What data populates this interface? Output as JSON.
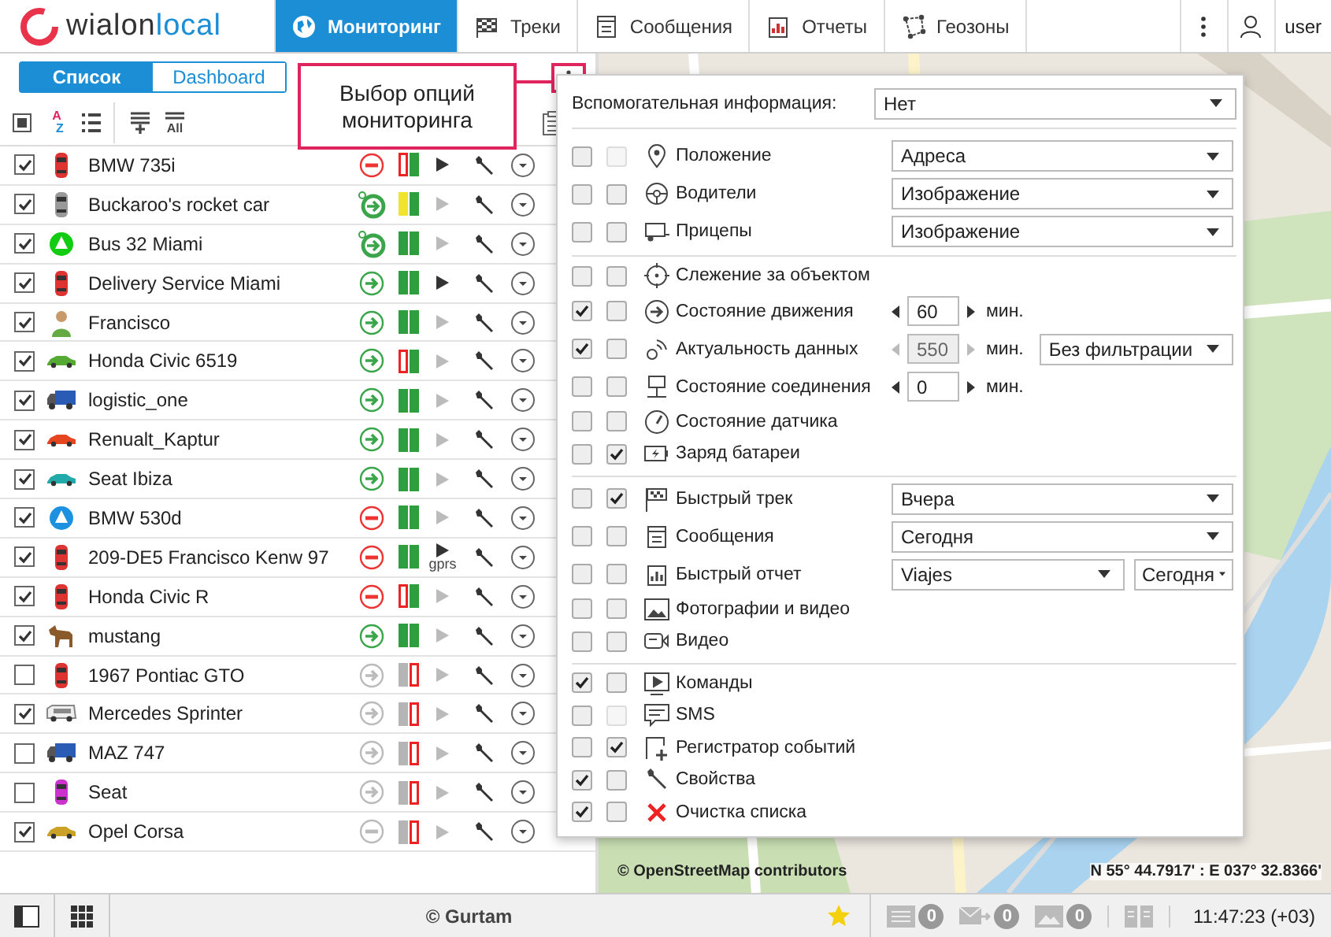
{
  "top_bar": {
    "logo": {
      "name": "wialon",
      "suffix": "local"
    },
    "nav": [
      {
        "label": "Мониторинг",
        "selected": true
      },
      {
        "label": "Треки",
        "selected": false
      },
      {
        "label": "Сообщения",
        "selected": false
      },
      {
        "label": "Отчеты",
        "selected": false
      },
      {
        "label": "Геозоны",
        "selected": false
      }
    ],
    "user": "user"
  },
  "panel": {
    "tabs": [
      {
        "label": "Список",
        "selected": true
      },
      {
        "label": "Dashboard",
        "selected": false
      }
    ],
    "select_all": {
      "indeterminate": true
    },
    "sort_label": {
      "first": "A",
      "second": "Z"
    },
    "all_label": "All"
  },
  "callout": {
    "text": "Выбор опций мониторинга"
  },
  "units": [
    {
      "name": "BMW 735i",
      "checked": true,
      "online": true,
      "moving": false,
      "watched": false,
      "gps_fix": false,
      "gps_weak": false,
      "connected": true,
      "command_enabled": true
    },
    {
      "name": "Buckaroo's rocket car",
      "checked": true,
      "online": true,
      "moving": true,
      "watched": true,
      "gps_fix": false,
      "gps_weak": true,
      "connected": true,
      "command_enabled": false
    },
    {
      "name": "Bus 32 Miami",
      "checked": true,
      "online": true,
      "moving": true,
      "watched": true,
      "gps_fix": true,
      "gps_weak": false,
      "connected": true,
      "command_enabled": false
    },
    {
      "name": "Delivery Service Miami",
      "checked": true,
      "online": true,
      "moving": true,
      "watched": false,
      "gps_fix": true,
      "gps_weak": false,
      "connected": true,
      "command_enabled": true
    },
    {
      "name": "Francisco",
      "checked": true,
      "online": true,
      "moving": true,
      "watched": false,
      "gps_fix": true,
      "gps_weak": false,
      "connected": true,
      "command_enabled": false
    },
    {
      "name": "Honda Civic 6519",
      "checked": true,
      "online": true,
      "moving": true,
      "watched": false,
      "gps_fix": false,
      "gps_weak": false,
      "connected": true,
      "command_enabled": false
    },
    {
      "name": "logistic_one",
      "checked": true,
      "online": true,
      "moving": true,
      "watched": false,
      "gps_fix": true,
      "gps_weak": false,
      "connected": true,
      "command_enabled": false
    },
    {
      "name": "Renualt_Kaptur",
      "checked": true,
      "online": true,
      "moving": true,
      "watched": false,
      "gps_fix": true,
      "gps_weak": false,
      "connected": true,
      "command_enabled": false
    },
    {
      "name": "Seat Ibiza",
      "checked": true,
      "online": true,
      "moving": true,
      "watched": false,
      "gps_fix": true,
      "gps_weak": false,
      "connected": true,
      "command_enabled": false
    },
    {
      "name": "BMW 530d",
      "checked": true,
      "online": true,
      "moving": false,
      "watched": false,
      "gps_fix": true,
      "gps_weak": false,
      "connected": true,
      "command_enabled": false
    },
    {
      "name": "209-DE5 Francisco Kenw 97",
      "checked": true,
      "online": true,
      "moving": false,
      "watched": false,
      "gps_fix": true,
      "gps_weak": false,
      "connected": true,
      "command_enabled": true,
      "command_label": "gprs"
    },
    {
      "name": "Honda Civic R",
      "checked": true,
      "online": true,
      "moving": false,
      "watched": false,
      "gps_fix": false,
      "gps_weak": false,
      "connected": true,
      "command_enabled": false
    },
    {
      "name": "mustang",
      "checked": true,
      "online": true,
      "moving": true,
      "watched": false,
      "gps_fix": true,
      "gps_weak": false,
      "connected": true,
      "command_enabled": false
    },
    {
      "name": "1967 Pontiac GTO",
      "checked": false,
      "online": false,
      "moving": true,
      "watched": false,
      "gps_fix": false,
      "gps_weak": false,
      "connected": false,
      "command_enabled": false
    },
    {
      "name": "Mercedes Sprinter",
      "checked": true,
      "online": false,
      "moving": true,
      "watched": false,
      "gps_fix": false,
      "gps_weak": false,
      "connected": false,
      "command_enabled": false
    },
    {
      "name": "MAZ 747",
      "checked": false,
      "online": false,
      "moving": true,
      "watched": false,
      "gps_fix": false,
      "gps_weak": false,
      "connected": false,
      "command_enabled": false
    },
    {
      "name": "Seat",
      "checked": false,
      "online": false,
      "moving": true,
      "watched": false,
      "gps_fix": false,
      "gps_weak": false,
      "connected": false,
      "command_enabled": false
    },
    {
      "name": "Opel Corsa",
      "checked": true,
      "online": false,
      "moving": false,
      "watched": false,
      "gps_fix": false,
      "gps_weak": false,
      "connected": false,
      "command_enabled": false
    }
  ],
  "options": {
    "header": {
      "label": "Вспомогательная информация:",
      "value": "Нет"
    },
    "sections": [
      [
        {
          "label": "Положение",
          "checks": [
            {
              "checked": false,
              "disabled": false
            },
            {
              "checked": false,
              "disabled": true
            }
          ],
          "controls": [
            {
              "kind": "select",
              "value": "Адреса"
            }
          ]
        },
        {
          "label": "Водители",
          "checks": [
            {
              "checked": false,
              "disabled": false
            },
            {
              "checked": false,
              "disabled": false
            }
          ],
          "controls": [
            {
              "kind": "select",
              "value": "Изображение"
            }
          ]
        },
        {
          "label": "Прицепы",
          "checks": [
            {
              "checked": false,
              "disabled": false
            },
            {
              "checked": false,
              "disabled": false
            }
          ],
          "controls": [
            {
              "kind": "select",
              "value": "Изображение"
            }
          ]
        }
      ],
      [
        {
          "label": "Слежение за объектом",
          "checks": [
            {
              "checked": false,
              "disabled": false
            },
            {
              "checked": false,
              "disabled": false
            }
          ]
        },
        {
          "label": "Состояние движения",
          "checks": [
            {
              "checked": true,
              "disabled": false
            },
            {
              "checked": false,
              "disabled": false
            }
          ],
          "controls": [
            {
              "kind": "spinner",
              "value": "60",
              "unit": "мин.",
              "disabled": false
            }
          ]
        },
        {
          "label": "Актуальность данных",
          "checks": [
            {
              "checked": true,
              "disabled": false
            },
            {
              "checked": false,
              "disabled": false
            }
          ],
          "controls": [
            {
              "kind": "spinner",
              "value": "550",
              "unit": "мин.",
              "disabled": true
            },
            {
              "kind": "select",
              "value": "Без фильтрации"
            }
          ]
        },
        {
          "label": "Состояние соединения",
          "checks": [
            {
              "checked": false,
              "disabled": false
            },
            {
              "checked": false,
              "disabled": false
            }
          ],
          "controls": [
            {
              "kind": "spinner",
              "value": "0",
              "unit": "мин.",
              "disabled": false
            }
          ]
        },
        {
          "label": "Состояние датчика",
          "checks": [
            {
              "checked": false,
              "disabled": false
            },
            {
              "checked": false,
              "disabled": false
            }
          ]
        },
        {
          "label": "Заряд батареи",
          "checks": [
            {
              "checked": false,
              "disabled": false
            },
            {
              "checked": true,
              "disabled": false
            }
          ]
        }
      ],
      [
        {
          "label": "Быстрый трек",
          "checks": [
            {
              "checked": false,
              "disabled": false
            },
            {
              "checked": true,
              "disabled": false
            }
          ],
          "controls": [
            {
              "kind": "select",
              "value": "Вчера"
            }
          ]
        },
        {
          "label": "Сообщения",
          "checks": [
            {
              "checked": false,
              "disabled": false
            },
            {
              "checked": false,
              "disabled": false
            }
          ],
          "controls": [
            {
              "kind": "select",
              "value": "Сегодня"
            }
          ]
        },
        {
          "label": "Быстрый отчет",
          "checks": [
            {
              "checked": false,
              "disabled": false
            },
            {
              "checked": false,
              "disabled": false
            }
          ],
          "controls": [
            {
              "kind": "select",
              "value": "Viajes"
            },
            {
              "kind": "select_small",
              "value": "Сегодня"
            }
          ]
        },
        {
          "label": "Фотографии и видео",
          "checks": [
            {
              "checked": false,
              "disabled": false
            },
            {
              "checked": false,
              "disabled": false
            }
          ]
        },
        {
          "label": "Видео",
          "checks": [
            {
              "checked": false,
              "disabled": false
            },
            {
              "checked": false,
              "disabled": false
            }
          ]
        }
      ],
      [
        {
          "label": "Команды",
          "checks": [
            {
              "checked": true,
              "disabled": false
            },
            {
              "checked": false,
              "disabled": false
            }
          ]
        },
        {
          "label": "SMS",
          "checks": [
            {
              "checked": false,
              "disabled": false
            },
            {
              "checked": false,
              "disabled": true
            }
          ]
        },
        {
          "label": "Регистратор событий",
          "checks": [
            {
              "checked": false,
              "disabled": false
            },
            {
              "checked": true,
              "disabled": false
            }
          ]
        },
        {
          "label": "Свойства",
          "checks": [
            {
              "checked": true,
              "disabled": false
            },
            {
              "checked": false,
              "disabled": false
            }
          ]
        },
        {
          "label": "Очистка списка",
          "checks": [
            {
              "checked": true,
              "disabled": false
            },
            {
              "checked": false,
              "disabled": false
            }
          ]
        }
      ]
    ]
  },
  "map": {
    "attribution": "© OpenStreetMap contributors",
    "coordinates": "N 55° 44.7917' : E 037° 32.8366'"
  },
  "status_bar": {
    "copyright": "© Gurtam",
    "counters": [
      "0",
      "0",
      "0"
    ],
    "time": "11:47:23 (+03)"
  }
}
